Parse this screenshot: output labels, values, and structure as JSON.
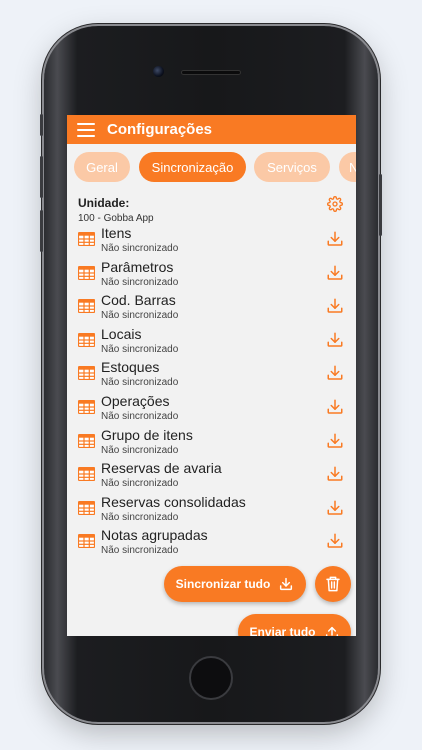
{
  "appbar": {
    "title": "Configurações"
  },
  "tabs": [
    {
      "label": "Geral",
      "active": false
    },
    {
      "label": "Sincronização",
      "active": true
    },
    {
      "label": "Serviços",
      "active": false
    },
    {
      "label": "N",
      "active": false
    }
  ],
  "unit": {
    "label": "Unidade:",
    "value": "100 - Gobba App"
  },
  "items": [
    {
      "name": "Itens",
      "status": "Não sincronizado"
    },
    {
      "name": "Parâmetros",
      "status": "Não sincronizado"
    },
    {
      "name": "Cod. Barras",
      "status": "Não sincronizado"
    },
    {
      "name": "Locais",
      "status": "Não sincronizado"
    },
    {
      "name": "Estoques",
      "status": "Não sincronizado"
    },
    {
      "name": "Operações",
      "status": "Não sincronizado"
    },
    {
      "name": "Grupo de itens",
      "status": "Não sincronizado"
    },
    {
      "name": "Reservas de avaria",
      "status": "Não sincronizado"
    },
    {
      "name": "Reservas consolidadas",
      "status": "Não sincronizado"
    },
    {
      "name": "Notas agrupadas",
      "status": "Não sincronizado"
    }
  ],
  "actions": {
    "sync_all": "Sincronizar tudo",
    "send_all": "Enviar tudo"
  },
  "colors": {
    "accent": "#f97a23",
    "accent_light": "#fbc9a6"
  }
}
